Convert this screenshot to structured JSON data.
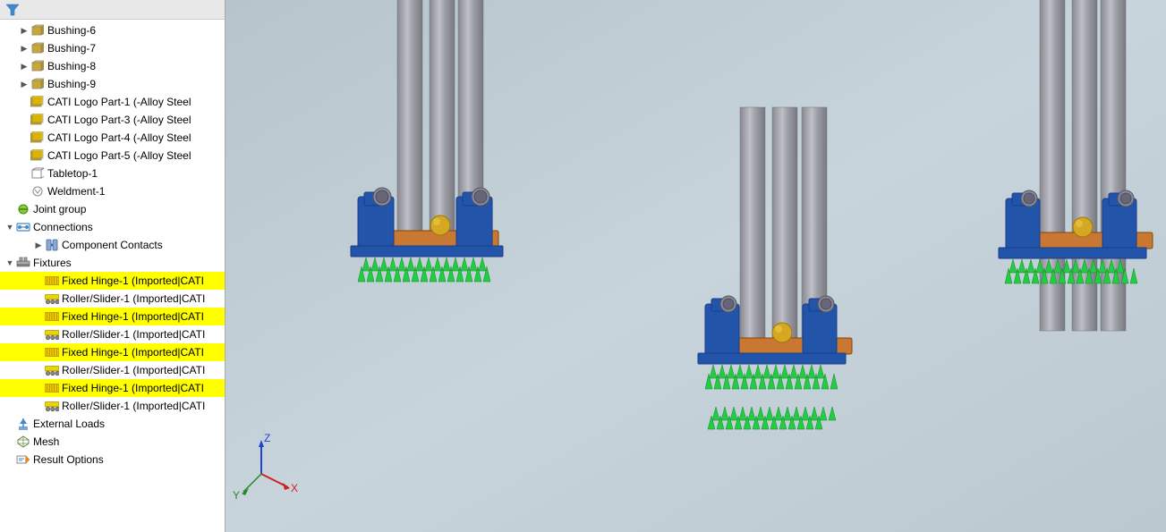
{
  "panel": {
    "filter_icon": "filter",
    "items": [
      {
        "id": "bushing6",
        "label": "Bushing-6",
        "indent": 1,
        "icon": "cube",
        "expandable": true,
        "expanded": false,
        "highlighted": false
      },
      {
        "id": "bushing7",
        "label": "Bushing-7",
        "indent": 1,
        "icon": "cube",
        "expandable": true,
        "expanded": false,
        "highlighted": false
      },
      {
        "id": "bushing8",
        "label": "Bushing-8",
        "indent": 1,
        "icon": "cube",
        "expandable": true,
        "expanded": false,
        "highlighted": false
      },
      {
        "id": "bushing9",
        "label": "Bushing-9",
        "indent": 1,
        "icon": "cube",
        "expandable": true,
        "expanded": false,
        "highlighted": false
      },
      {
        "id": "cati-logo1",
        "label": "CATI Logo Part-1 (-Alloy Steel",
        "indent": 1,
        "icon": "part-yellow",
        "expandable": false,
        "expanded": false,
        "highlighted": false
      },
      {
        "id": "cati-logo3",
        "label": "CATI Logo Part-3 (-Alloy Steel",
        "indent": 1,
        "icon": "part-yellow",
        "expandable": false,
        "expanded": false,
        "highlighted": false
      },
      {
        "id": "cati-logo4",
        "label": "CATI Logo Part-4 (-Alloy Steel",
        "indent": 1,
        "icon": "part-yellow",
        "expandable": false,
        "expanded": false,
        "highlighted": false
      },
      {
        "id": "cati-logo5",
        "label": "CATI Logo Part-5 (-Alloy Steel",
        "indent": 1,
        "icon": "part-yellow",
        "expandable": false,
        "expanded": false,
        "highlighted": false
      },
      {
        "id": "tabletop",
        "label": "Tabletop-1",
        "indent": 1,
        "icon": "cube-outline",
        "expandable": false,
        "expanded": false,
        "highlighted": false
      },
      {
        "id": "weldment",
        "label": "Weldment-1",
        "indent": 1,
        "icon": "part-sm",
        "expandable": false,
        "expanded": false,
        "highlighted": false
      },
      {
        "id": "joint-group",
        "label": "Joint group",
        "indent": 0,
        "icon": "joint",
        "expandable": false,
        "expanded": false,
        "highlighted": false
      },
      {
        "id": "connections",
        "label": "Connections",
        "indent": 0,
        "icon": "connections",
        "expandable": true,
        "expanded": true,
        "highlighted": false
      },
      {
        "id": "component-contacts",
        "label": "Component Contacts",
        "indent": 1,
        "icon": "contacts",
        "expandable": true,
        "expanded": false,
        "highlighted": false
      },
      {
        "id": "fixtures",
        "label": "Fixtures",
        "indent": 0,
        "icon": "fixtures",
        "expandable": true,
        "expanded": true,
        "highlighted": false
      },
      {
        "id": "fixed-hinge-1a",
        "label": "Fixed Hinge-1 (Imported|CATI",
        "indent": 1,
        "icon": "fixture-fixed",
        "expandable": false,
        "expanded": false,
        "highlighted": true
      },
      {
        "id": "roller-slider-1a",
        "label": "Roller/Slider-1 (Imported|CATI",
        "indent": 1,
        "icon": "fixture-roller",
        "expandable": false,
        "expanded": false,
        "highlighted": false
      },
      {
        "id": "fixed-hinge-1b",
        "label": "Fixed Hinge-1 (Imported|CATI",
        "indent": 1,
        "icon": "fixture-fixed",
        "expandable": false,
        "expanded": false,
        "highlighted": true
      },
      {
        "id": "roller-slider-1b",
        "label": "Roller/Slider-1 (Imported|CATI",
        "indent": 1,
        "icon": "fixture-roller",
        "expandable": false,
        "expanded": false,
        "highlighted": false
      },
      {
        "id": "fixed-hinge-1c",
        "label": "Fixed Hinge-1 (Imported|CATI",
        "indent": 1,
        "icon": "fixture-fixed",
        "expandable": false,
        "expanded": false,
        "highlighted": true
      },
      {
        "id": "roller-slider-1c",
        "label": "Roller/Slider-1 (Imported|CATI",
        "indent": 1,
        "icon": "fixture-roller",
        "expandable": false,
        "expanded": false,
        "highlighted": false
      },
      {
        "id": "fixed-hinge-1d",
        "label": "Fixed Hinge-1 (Imported|CATI",
        "indent": 1,
        "icon": "fixture-fixed",
        "expandable": false,
        "expanded": false,
        "highlighted": true
      },
      {
        "id": "roller-slider-1d",
        "label": "Roller/Slider-1 (Imported|CATI",
        "indent": 1,
        "icon": "fixture-roller",
        "expandable": false,
        "expanded": false,
        "highlighted": false
      },
      {
        "id": "external-loads",
        "label": "External Loads",
        "indent": 0,
        "icon": "ext-loads",
        "expandable": false,
        "expanded": false,
        "highlighted": false
      },
      {
        "id": "mesh",
        "label": "Mesh",
        "indent": 0,
        "icon": "mesh",
        "expandable": false,
        "expanded": false,
        "highlighted": false
      },
      {
        "id": "result-options",
        "label": "Result Options",
        "indent": 0,
        "icon": "result",
        "expandable": false,
        "expanded": false,
        "highlighted": false
      }
    ]
  },
  "axis": {
    "x_label": "X",
    "y_label": "Y",
    "z_label": "Z"
  }
}
